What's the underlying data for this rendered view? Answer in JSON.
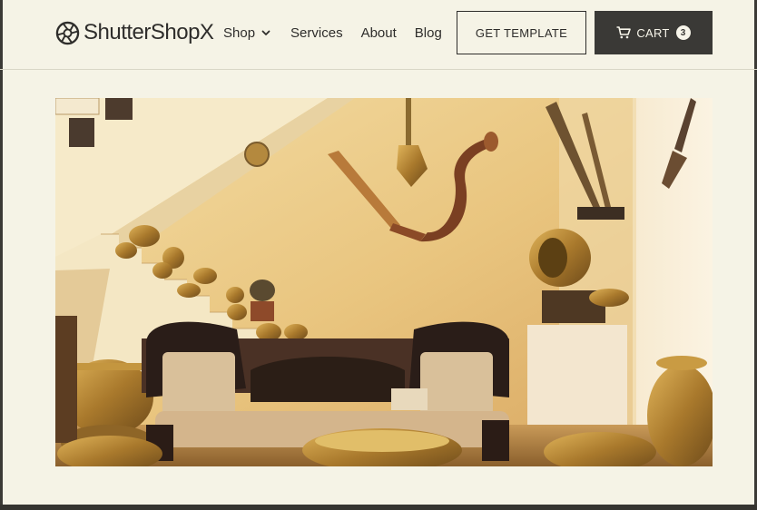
{
  "brand": {
    "name": "ShutterShopX",
    "icon": "aperture-logo-icon"
  },
  "nav": {
    "items": [
      {
        "label": "Shop",
        "has_dropdown": true
      },
      {
        "label": "Services"
      },
      {
        "label": "About"
      },
      {
        "label": "Blog"
      }
    ]
  },
  "actions": {
    "template_label": "GET TEMPLATE",
    "cart_label": "CART",
    "cart_count": "3"
  },
  "hero": {
    "subject": "antique-brass-collection-room"
  },
  "colors": {
    "page_bg": "#f5f3e6",
    "text": "#2e2d2b",
    "cart_bg": "#3a3936",
    "accent_gold": "#b8892f"
  }
}
